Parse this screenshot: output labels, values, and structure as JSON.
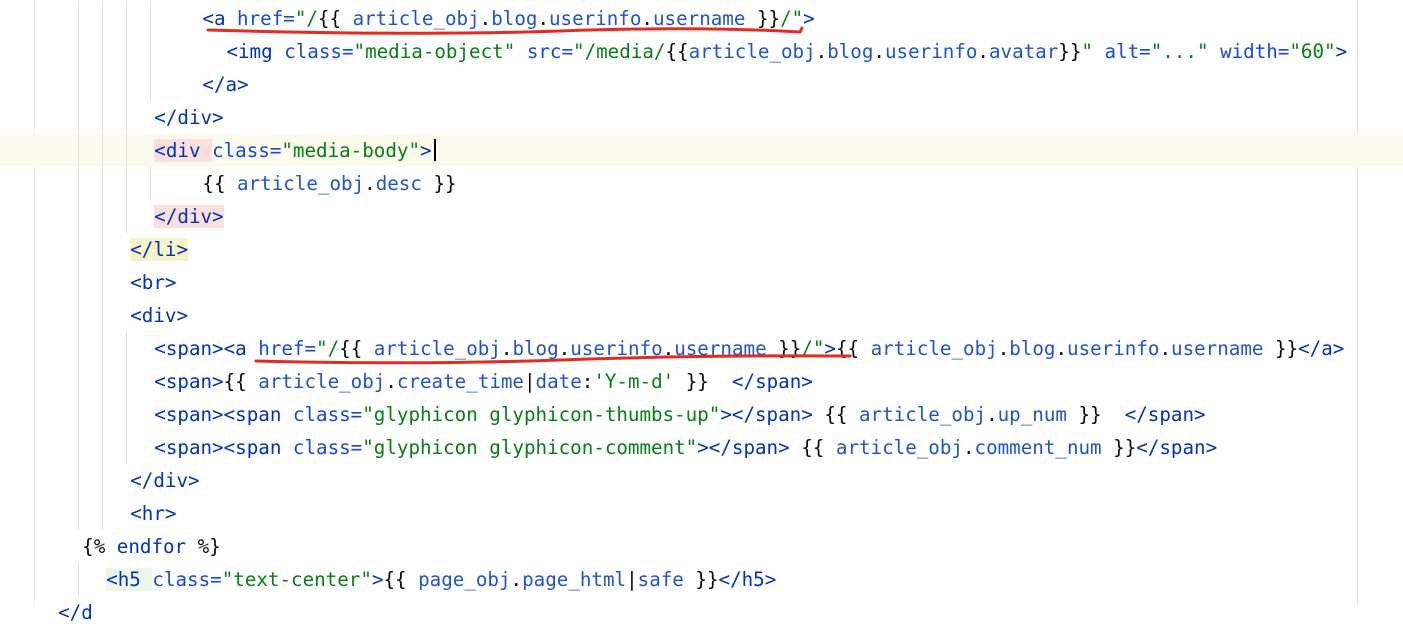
{
  "editor": {
    "lines": [
      {
        "indent": "        ",
        "tokens": [
          [
            "tag",
            "<a "
          ],
          [
            "attr",
            "href="
          ],
          [
            "str",
            "\"/"
          ],
          [
            "pun",
            "{{ "
          ],
          [
            "var",
            "article_obj"
          ],
          [
            "pun",
            "."
          ],
          [
            "var",
            "blog"
          ],
          [
            "pun",
            "."
          ],
          [
            "var",
            "userinfo"
          ],
          [
            "pun",
            "."
          ],
          [
            "var",
            "username"
          ],
          [
            "pun",
            " }}"
          ],
          [
            "str",
            "/\""
          ],
          [
            "tag",
            ">"
          ]
        ]
      },
      {
        "indent": "         ",
        "tokens": [
          [
            "tag",
            "<img "
          ],
          [
            "attr",
            "class="
          ],
          [
            "str",
            "\"media-object\""
          ],
          [
            "pun",
            " "
          ],
          [
            "attr",
            "src="
          ],
          [
            "str",
            "\"/media/"
          ],
          [
            "pun",
            "{{"
          ],
          [
            "var",
            "article_obj"
          ],
          [
            "pun",
            "."
          ],
          [
            "var",
            "blog"
          ],
          [
            "pun",
            "."
          ],
          [
            "var",
            "userinfo"
          ],
          [
            "pun",
            "."
          ],
          [
            "var",
            "avatar"
          ],
          [
            "pun",
            "}}"
          ],
          [
            "str",
            "\""
          ],
          [
            "pun",
            " "
          ],
          [
            "attr",
            "alt="
          ],
          [
            "str",
            "\"...\""
          ],
          [
            "pun",
            " "
          ],
          [
            "attr",
            "width="
          ],
          [
            "str",
            "\"60\""
          ],
          [
            "tag",
            ">"
          ]
        ]
      },
      {
        "indent": "        ",
        "tokens": [
          [
            "tag",
            "</a>"
          ]
        ]
      },
      {
        "indent": "      ",
        "tokens": [
          [
            "tag",
            "</div>"
          ]
        ]
      },
      {
        "indent": "      ",
        "tokens": [
          [
            "tag",
            "<div "
          ],
          [
            "attr",
            "class="
          ],
          [
            "str",
            "\"media-body\""
          ],
          [
            "tag",
            ">"
          ]
        ]
      },
      {
        "indent": "        ",
        "tokens": [
          [
            "pun",
            "{{ "
          ],
          [
            "var",
            "article_obj"
          ],
          [
            "pun",
            "."
          ],
          [
            "var",
            "desc"
          ],
          [
            "pun",
            " }}"
          ]
        ]
      },
      {
        "indent": "      ",
        "tokens": [
          [
            "tag",
            "</div>"
          ]
        ]
      },
      {
        "indent": "     ",
        "tokens": [
          [
            "tag",
            "</li>"
          ]
        ]
      },
      {
        "indent": "     ",
        "tokens": [
          [
            "tag",
            "<br>"
          ]
        ]
      },
      {
        "indent": "     ",
        "tokens": [
          [
            "tag",
            "<div>"
          ]
        ]
      },
      {
        "indent": "      ",
        "tokens": [
          [
            "tag",
            "<span><a "
          ],
          [
            "attr",
            "href="
          ],
          [
            "str",
            "\"/"
          ],
          [
            "pun",
            "{{ "
          ],
          [
            "var",
            "article_obj"
          ],
          [
            "pun",
            "."
          ],
          [
            "var",
            "blog"
          ],
          [
            "pun",
            "."
          ],
          [
            "var",
            "userinfo"
          ],
          [
            "pun",
            "."
          ],
          [
            "var",
            "username"
          ],
          [
            "pun",
            " }}"
          ],
          [
            "str",
            "/\""
          ],
          [
            "tag",
            ">"
          ],
          [
            "pun",
            "{{ "
          ],
          [
            "var",
            "article_obj"
          ],
          [
            "pun",
            "."
          ],
          [
            "var",
            "blog"
          ],
          [
            "pun",
            "."
          ],
          [
            "var",
            "userinfo"
          ],
          [
            "pun",
            "."
          ],
          [
            "var",
            "username"
          ],
          [
            "pun",
            " }}"
          ],
          [
            "tag",
            "</a>"
          ]
        ]
      },
      {
        "indent": "      ",
        "tokens": [
          [
            "tag",
            "<span>"
          ],
          [
            "pun",
            "{{ "
          ],
          [
            "var",
            "article_obj"
          ],
          [
            "pun",
            "."
          ],
          [
            "var",
            "create_time"
          ],
          [
            "pun",
            "|"
          ],
          [
            "var",
            "date"
          ],
          [
            "pun",
            ":"
          ],
          [
            "str",
            "'Y-m-d'"
          ],
          [
            "pun",
            " }}  "
          ],
          [
            "tag",
            "</span>"
          ]
        ]
      },
      {
        "indent": "      ",
        "tokens": [
          [
            "tag",
            "<span><span "
          ],
          [
            "attr",
            "class="
          ],
          [
            "str",
            "\"glyphicon glyphicon-thumbs-up\""
          ],
          [
            "tag",
            "></span>"
          ],
          [
            "pun",
            " {{ "
          ],
          [
            "var",
            "article_obj"
          ],
          [
            "pun",
            "."
          ],
          [
            "var",
            "up_num"
          ],
          [
            "pun",
            " }}  "
          ],
          [
            "tag",
            "</span>"
          ]
        ]
      },
      {
        "indent": "      ",
        "tokens": [
          [
            "tag",
            "<span><span "
          ],
          [
            "attr",
            "class="
          ],
          [
            "str",
            "\"glyphicon glyphicon-comment\""
          ],
          [
            "tag",
            "></span>"
          ],
          [
            "pun",
            " {{ "
          ],
          [
            "var",
            "article_obj"
          ],
          [
            "pun",
            "."
          ],
          [
            "var",
            "comment_num"
          ],
          [
            "pun",
            " }}"
          ],
          [
            "tag",
            "</span>"
          ]
        ]
      },
      {
        "indent": "     ",
        "tokens": [
          [
            "tag",
            "</div>"
          ]
        ]
      },
      {
        "indent": "     ",
        "tokens": [
          [
            "tag",
            "<hr>"
          ]
        ]
      },
      {
        "indent": "   ",
        "tokens": [
          [
            "pun",
            "{% "
          ],
          [
            "tag",
            "endfor"
          ],
          [
            "pun",
            " %}"
          ]
        ]
      },
      {
        "indent": "    ",
        "tokens": [
          [
            "tag",
            "<h5 "
          ],
          [
            "attr",
            "class="
          ],
          [
            "str",
            "\"text-center\""
          ],
          [
            "tag",
            ">"
          ],
          [
            "pun",
            "{{ "
          ],
          [
            "var",
            "page_obj"
          ],
          [
            "pun",
            "."
          ],
          [
            "var",
            "page_html"
          ],
          [
            "pun",
            "|"
          ],
          [
            "var",
            "safe"
          ],
          [
            "pun",
            " }}"
          ],
          [
            "tag",
            "</h5>"
          ]
        ]
      },
      {
        "indent": "  ",
        "tokens": [
          [
            "tag",
            "</d"
          ]
        ]
      }
    ]
  }
}
